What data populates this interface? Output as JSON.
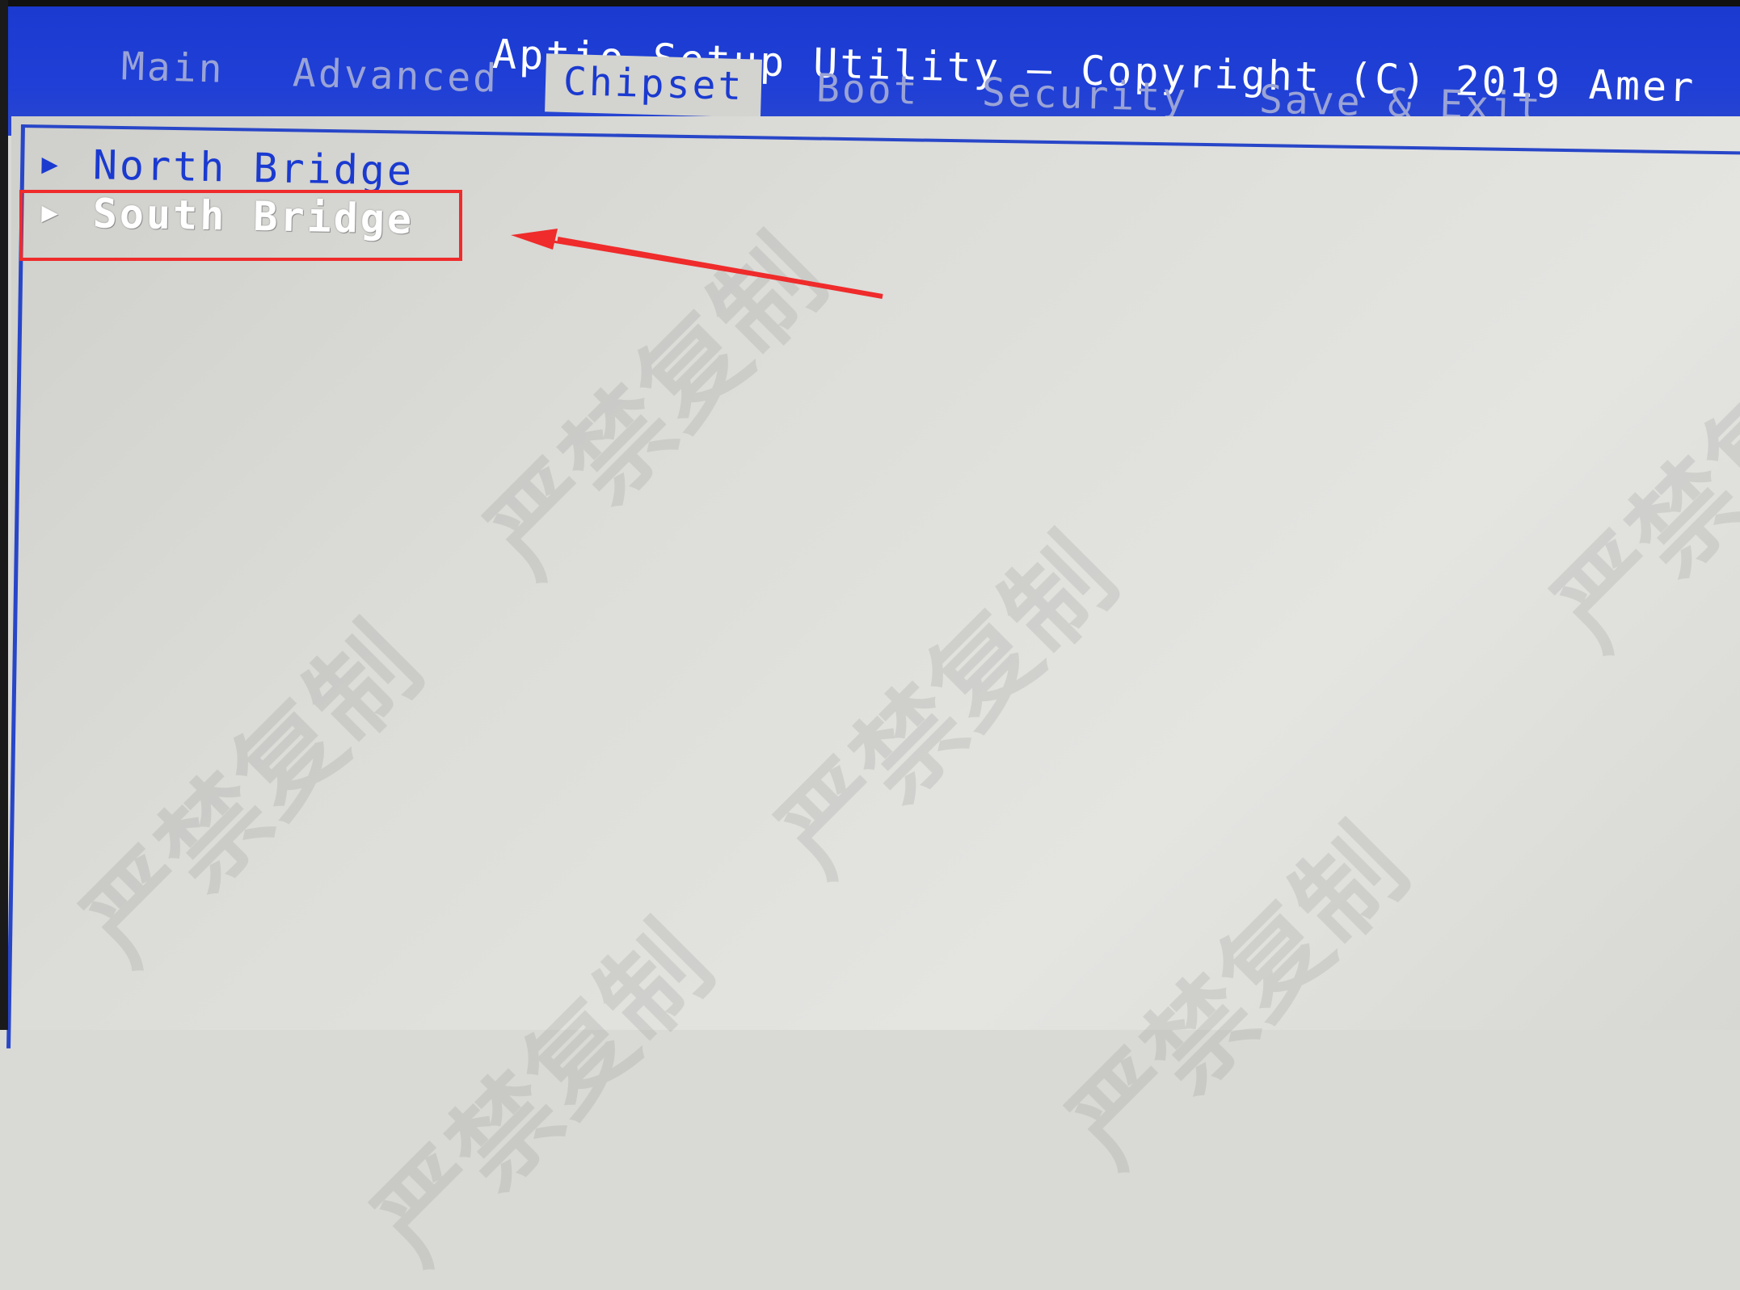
{
  "header": {
    "title": "Aptio Setup Utility – Copyright (C) 2019 Amer",
    "tabs": [
      {
        "label": "Main"
      },
      {
        "label": "Advanced"
      },
      {
        "label": "Chipset"
      },
      {
        "label": "Boot"
      },
      {
        "label": "Security"
      },
      {
        "label": "Save & Exit"
      }
    ],
    "active_tab": "Chipset"
  },
  "menu": {
    "items": [
      {
        "label": "North Bridge"
      },
      {
        "label": "South Bridge"
      }
    ],
    "selected": "South Bridge"
  },
  "watermark": {
    "text": "严禁复制"
  },
  "colors": {
    "header_blue": "#1f3fd6",
    "panel_gray": "#d9d9d6",
    "annotation_red": "#ef2b2b"
  }
}
